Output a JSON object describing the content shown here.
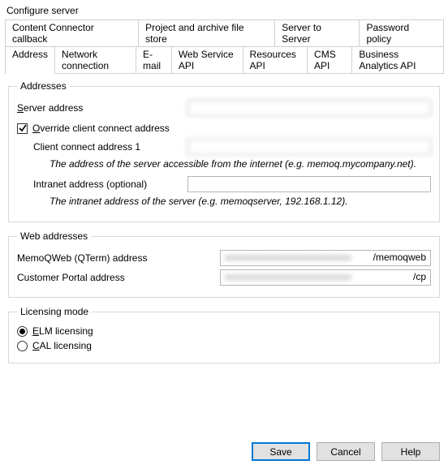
{
  "window": {
    "title": "Configure server"
  },
  "tabs_row1": [
    "Content Connector callback",
    "Project and archive file store",
    "Server to Server",
    "Password policy"
  ],
  "tabs_row2": [
    "Address",
    "Network connection",
    "E-mail",
    "Web Service API",
    "Resources API",
    "CMS API",
    "Business Analytics API"
  ],
  "active_tab": "Address",
  "groups": {
    "addresses": {
      "legend": "Addresses",
      "server_address": {
        "label": "Server address",
        "value": ""
      },
      "override": {
        "label": "Override client connect address",
        "checked": true
      },
      "client_connect": {
        "label": "Client connect address 1",
        "value": "",
        "hint": "The address of the server accessible from the internet (e.g. memoq.mycompany.net)."
      },
      "intranet": {
        "label": "Intranet address (optional)",
        "value": "",
        "hint": "The intranet address of the server (e.g. memoqserver, 192.168.1.12)."
      }
    },
    "web": {
      "legend": "Web addresses",
      "memoqweb": {
        "label": "MemoQWeb (QTerm) address",
        "value": "",
        "suffix": "/memoqweb"
      },
      "portal": {
        "label": "Customer Portal address",
        "value": "",
        "suffix": "/cp"
      }
    },
    "licensing": {
      "legend": "Licensing mode",
      "elm": {
        "label": "ELM licensing",
        "selected": true
      },
      "cal": {
        "label": "CAL licensing",
        "selected": false
      }
    }
  },
  "buttons": {
    "save": "Save",
    "cancel": "Cancel",
    "help": "Help"
  }
}
